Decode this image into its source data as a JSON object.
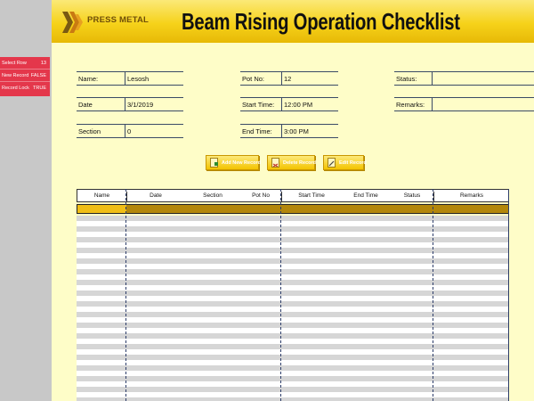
{
  "status_panel": {
    "rows": [
      {
        "label": "Select Row",
        "value": "13"
      },
      {
        "label": "New Record",
        "value": "FALSE"
      },
      {
        "label": "Record Lock",
        "value": "TRUE"
      }
    ]
  },
  "header": {
    "logo_text": "PRESS METAL",
    "title": "Beam Rising Operation Checklist"
  },
  "form": {
    "name_label": "Name:",
    "name_value": "Lesosh",
    "date_label": "Date",
    "date_value": "3/1/2019",
    "section_label": "Section",
    "section_value": "0",
    "potno_label": "Pot No:",
    "potno_value": "12",
    "start_label": "Start Time:",
    "start_value": "12:00 PM",
    "end_label": "End Time:",
    "end_value": "3:00 PM",
    "status_label": "Status:",
    "status_value": "",
    "remarks_label": "Remarks:",
    "remarks_value": ""
  },
  "buttons": {
    "add": "Add New Record",
    "delete": "Delete Record",
    "edit": "Edit Record"
  },
  "table": {
    "columns": [
      "Name",
      "Date",
      "Section",
      "Pot No",
      "Start Time",
      "End Time",
      "Status",
      "Remarks"
    ]
  },
  "colors": {
    "accent_yellow": "#f6d21a",
    "sheet_bg": "#fefdc8",
    "status_red": "#e4374b",
    "selected_row": "#b3870b"
  }
}
